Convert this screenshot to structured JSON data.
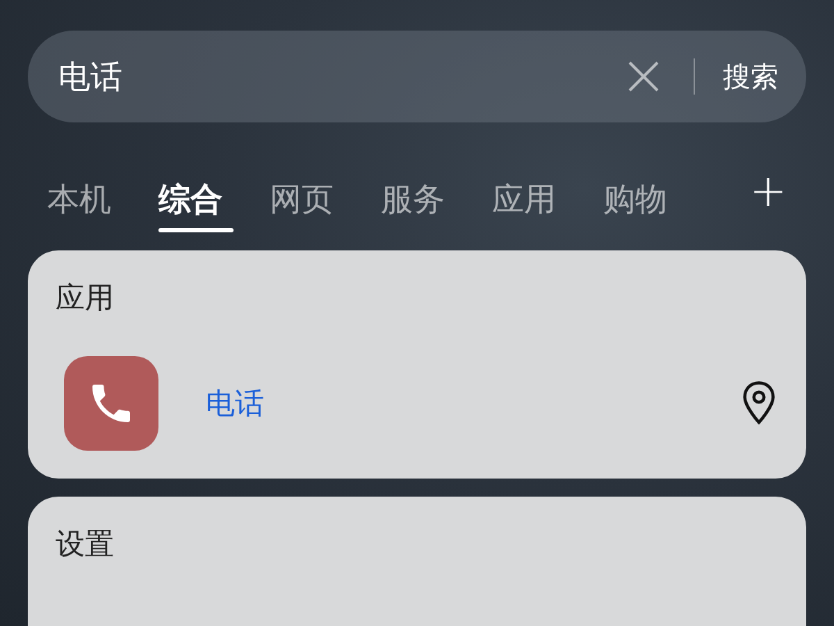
{
  "search": {
    "value": "电话",
    "button": "搜索"
  },
  "tabs": [
    {
      "label": "本机",
      "selected": false
    },
    {
      "label": "综合",
      "selected": true
    },
    {
      "label": "网页",
      "selected": false
    },
    {
      "label": "服务",
      "selected": false
    },
    {
      "label": "应用",
      "selected": false
    },
    {
      "label": "购物",
      "selected": false
    }
  ],
  "add_tab": "+",
  "sections": [
    {
      "title": "应用",
      "items": [
        {
          "name": "电话"
        }
      ]
    },
    {
      "title": "设置"
    }
  ]
}
